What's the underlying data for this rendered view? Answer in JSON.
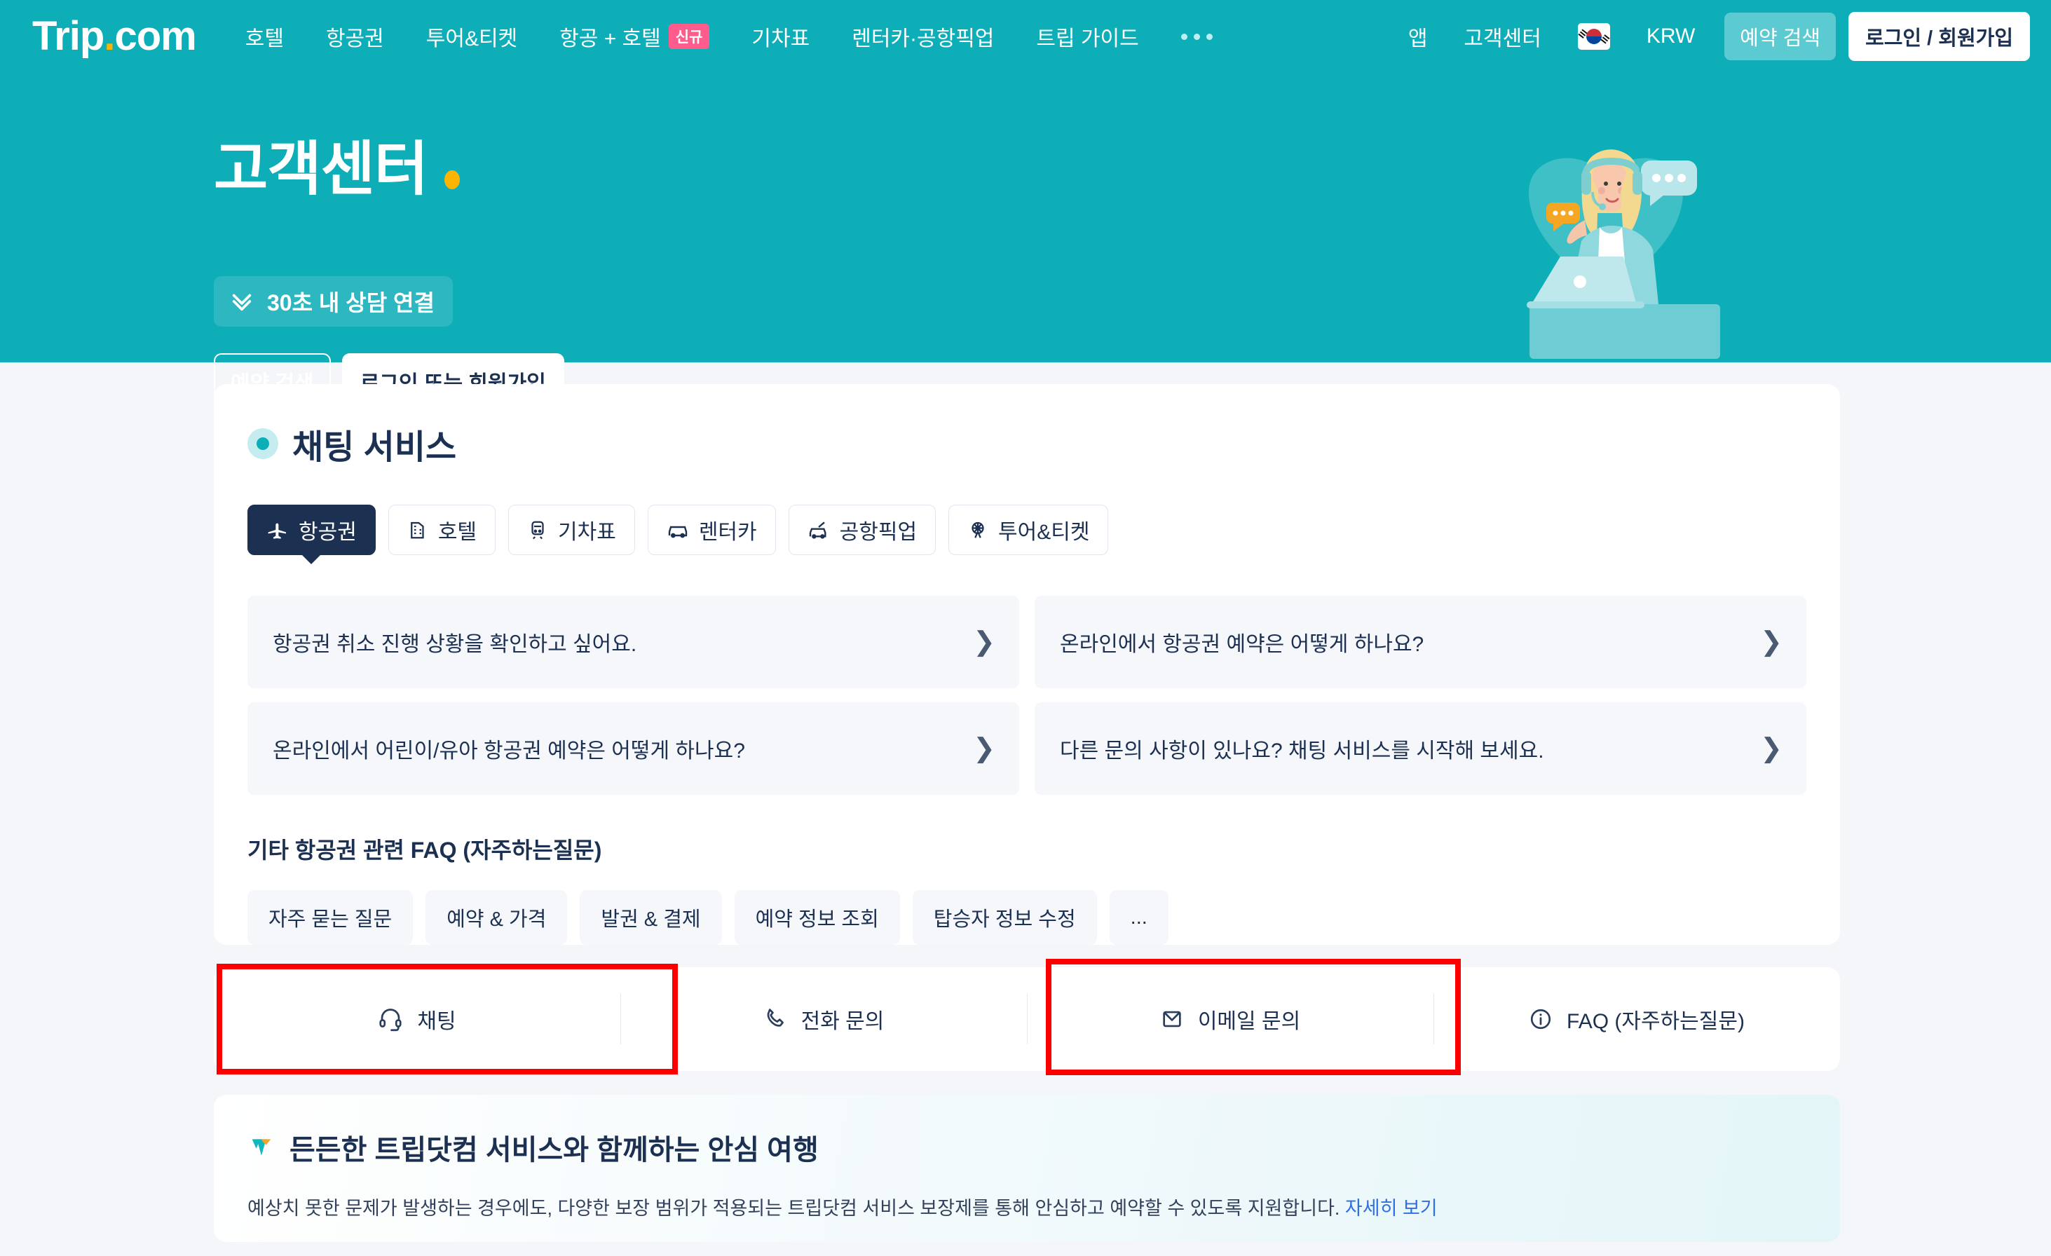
{
  "brand": {
    "name_main": "Trip",
    "name_dot": ".",
    "name_suffix": "com"
  },
  "topnav": {
    "items": [
      {
        "label": "호텔",
        "badge": ""
      },
      {
        "label": "항공권",
        "badge": ""
      },
      {
        "label": "투어&티켓",
        "badge": ""
      },
      {
        "label": "항공 + 호텔",
        "badge": "신규"
      },
      {
        "label": "기차표",
        "badge": ""
      },
      {
        "label": "렌터카·공항픽업",
        "badge": ""
      },
      {
        "label": "트립 가이드",
        "badge": ""
      }
    ],
    "more_icon": "ellipsis-icon",
    "right": {
      "app": "앱",
      "support": "고객센터",
      "flag_icon": "korea-flag-icon",
      "currency": "KRW",
      "search_button": "예약 검색",
      "login_button": "로그인 / 회원가입"
    }
  },
  "hero": {
    "title": "고객센터",
    "pill_icon": "double-chevron-down-icon",
    "pill_label": "30초 내 상담 연결",
    "btn_outline": "예약 검색",
    "btn_solid": "로그인 또는 회원가입",
    "illustration_icon": "support-agent-illustration"
  },
  "chat_card": {
    "title": "채팅 서비스",
    "tabs": [
      {
        "label": "항공권",
        "icon": "airplane-icon",
        "active": true
      },
      {
        "label": "호텔",
        "icon": "hotel-icon",
        "active": false
      },
      {
        "label": "기차표",
        "icon": "train-icon",
        "active": false
      },
      {
        "label": "렌터카",
        "icon": "car-icon",
        "active": false
      },
      {
        "label": "공항픽업",
        "icon": "airport-transfer-icon",
        "active": false
      },
      {
        "label": "투어&티켓",
        "icon": "ferris-wheel-icon",
        "active": false
      }
    ],
    "questions": [
      "항공권 취소 진행 상황을 확인하고 싶어요.",
      "온라인에서 항공권 예약은 어떻게 하나요?",
      "온라인에서 어린이/유아 항공권 예약은 어떻게 하나요?",
      "다른 문의 사항이 있나요? 채팅 서비스를 시작해 보세요."
    ],
    "chevron_glyph": "❯",
    "faq_heading": "기타 항공권 관련 FAQ (자주하는질문)",
    "faq_chips": [
      "자주 묻는 질문",
      "예약 & 가격",
      "발권 & 결제",
      "예약 정보 조회",
      "탑승자 정보 수정",
      "..."
    ]
  },
  "contact_bar": {
    "items": [
      {
        "label": "채팅",
        "icon": "headset-icon",
        "highlighted": true
      },
      {
        "label": "전화 문의",
        "icon": "phone-icon",
        "highlighted": false
      },
      {
        "label": "이메일 문의",
        "icon": "envelope-icon",
        "highlighted": true
      },
      {
        "label": "FAQ (자주하는질문)",
        "icon": "info-circle-icon",
        "highlighted": false
      }
    ],
    "highlight_color": "#fa0000"
  },
  "guarantee": {
    "icon": "trip-guarantee-heart-icon",
    "title": "든든한 트립닷컴 서비스와 함께하는 안심 여행",
    "body": "예상치 못한 문제가 발생하는 경우에도, 다양한 보장 범위가 적용되는 트립닷컴 서비스 보장제를 통해 안심하고 예약할 수 있도록 지원합니다.",
    "link": "자세히 보기"
  },
  "colors": {
    "brand_teal": "#0eaeb8",
    "navy": "#1c3052",
    "page_bg": "#f4f6fa",
    "accent_orange": "#ffb400",
    "badge_pink": "#ff5c8d",
    "link_blue": "#2f6fe0"
  }
}
